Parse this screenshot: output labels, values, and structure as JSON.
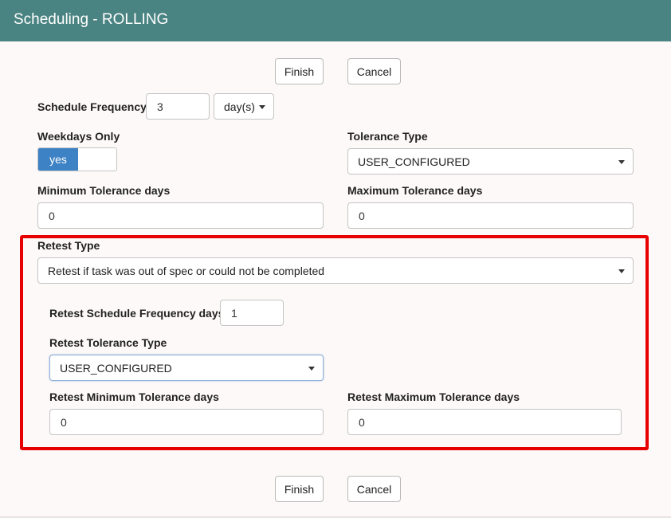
{
  "window": {
    "title": "Scheduling - ROLLING"
  },
  "actions": {
    "finish_label": "Finish",
    "cancel_label": "Cancel"
  },
  "schedule_frequency": {
    "label": "Schedule Frequency",
    "value": "3",
    "unit": "day(s)"
  },
  "weekdays_only": {
    "label": "Weekdays Only",
    "value": "yes"
  },
  "tolerance_type": {
    "label": "Tolerance Type",
    "value": "USER_CONFIGURED"
  },
  "min_tolerance": {
    "label": "Minimum Tolerance days",
    "value": "0"
  },
  "max_tolerance": {
    "label": "Maximum Tolerance days",
    "value": "0"
  },
  "retest": {
    "type_label": "Retest Type",
    "type_value": "Retest if task was out of spec or could not be completed",
    "frequency_label": "Retest Schedule Frequency days",
    "frequency_value": "1",
    "tolerance_type_label": "Retest Tolerance Type",
    "tolerance_type_value": "USER_CONFIGURED",
    "min_label": "Retest Minimum Tolerance days",
    "min_value": "0",
    "max_label": "Retest Maximum Tolerance days",
    "max_value": "0"
  },
  "colors": {
    "titlebar": "#4a8482",
    "toggle_on": "#3d82c4",
    "highlight": "#e60000"
  },
  "icons": {
    "dropdown": "caret-down-icon"
  }
}
